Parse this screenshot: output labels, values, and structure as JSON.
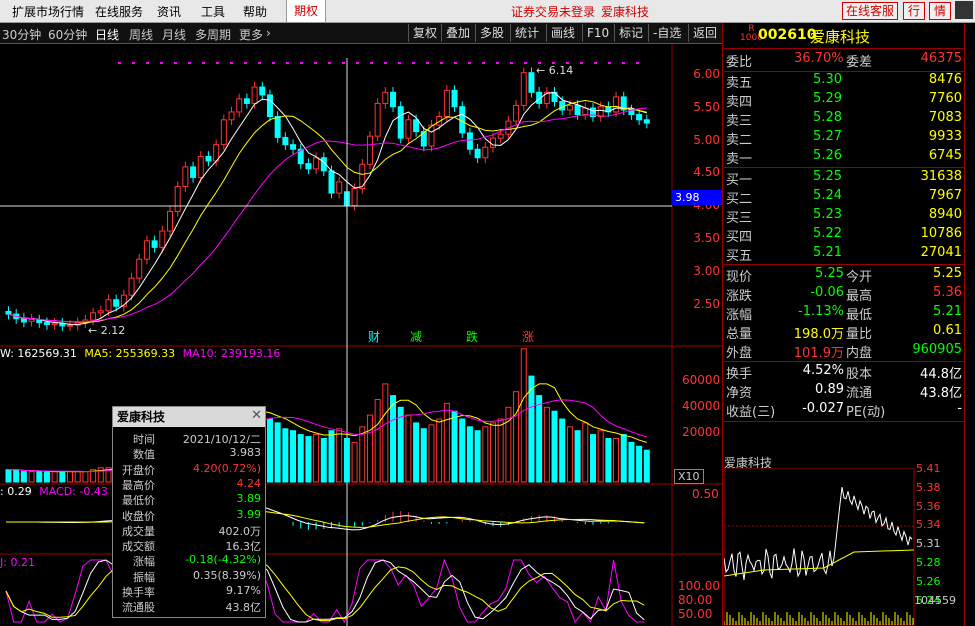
{
  "menu": {
    "items": [
      "扩展市场行情",
      "在线服务",
      "资讯",
      "工具",
      "帮助"
    ],
    "futures_tab": "期权",
    "status": "证券交易未登录",
    "stock_name": "爱康科技",
    "online_service": "在线客服",
    "quote_btn": "行",
    "quote_btn2": "情"
  },
  "toolbar": {
    "periods": [
      "30分钟",
      "60分钟",
      "日线",
      "周线",
      "月线",
      "多周期",
      "更多"
    ],
    "active_period": "日线",
    "tools": [
      "复权",
      "叠加",
      "多股",
      "统计",
      "画线",
      "F10",
      "标记",
      "-自选",
      "返回"
    ]
  },
  "quote": {
    "code": "002610",
    "name": "爱康科技",
    "r_label": "R",
    "r_sub": "1000",
    "webi_label": "委比",
    "webi": "36.70%",
    "weicha_label": "委差",
    "weicha": "46375",
    "asks": [
      {
        "label": "卖五",
        "price": "5.30",
        "vol": "8476"
      },
      {
        "label": "卖四",
        "price": "5.29",
        "vol": "7760"
      },
      {
        "label": "卖三",
        "price": "5.28",
        "vol": "7083"
      },
      {
        "label": "卖二",
        "price": "5.27",
        "vol": "9933"
      },
      {
        "label": "卖一",
        "price": "5.26",
        "vol": "6745"
      }
    ],
    "bids": [
      {
        "label": "买一",
        "price": "5.25",
        "vol": "31638"
      },
      {
        "label": "买二",
        "price": "5.24",
        "vol": "7967"
      },
      {
        "label": "买三",
        "price": "5.23",
        "vol": "8940"
      },
      {
        "label": "买四",
        "price": "5.22",
        "vol": "10786"
      },
      {
        "label": "买五",
        "price": "5.21",
        "vol": "27041"
      }
    ],
    "stats": [
      {
        "l1": "现价",
        "v1": "5.25",
        "l2": "今开",
        "v2": "5.25"
      },
      {
        "l1": "涨跌",
        "v1": "-0.06",
        "l2": "最高",
        "v2": "5.36"
      },
      {
        "l1": "涨幅",
        "v1": "-1.13%",
        "l2": "最低",
        "v2": "5.21"
      },
      {
        "l1": "总量",
        "v1": "198.0万",
        "l2": "量比",
        "v2": "0.61"
      },
      {
        "l1": "外盘",
        "v1": "101.9万",
        "l2": "内盘",
        "v2": "960905"
      }
    ],
    "stats2": [
      {
        "l1": "换手",
        "v1": "4.52%",
        "l2": "股本",
        "v2": "44.8亿"
      },
      {
        "l1": "净资",
        "v1": "0.89",
        "l2": "流通",
        "v2": "43.8亿"
      },
      {
        "l1": "收益(三)",
        "v1": "-0.027",
        "l2": "PE(动)",
        "v2": "-"
      }
    ],
    "mini_title": "爱康科技",
    "mini_ticks": [
      "5.41",
      "5.38",
      "5.36",
      "5.34",
      "5.31",
      "5.28",
      "5.26",
      "5.24"
    ],
    "mini_vol": "104559"
  },
  "chart": {
    "price_ticks": [
      "6.00",
      "5.50",
      "5.00",
      "4.50",
      "4.00",
      "3.50",
      "3.00",
      "2.50"
    ],
    "crosshair_price": "3.98",
    "high_label": "6.14",
    "low_label": "2.12",
    "events": [
      "财",
      "减",
      "跌",
      "涨"
    ],
    "vol_header": {
      "v": "W: 162569.31",
      "ma5": "MA5: 255369.33",
      "ma10": "MA10: 239193.16"
    },
    "vol_ticks": [
      "60000",
      "40000",
      "20000"
    ],
    "vol_unit": "X10",
    "macd_header": {
      "dif": ": 0.29",
      "macd": "MACD: -0.43"
    },
    "macd_tick": "0.50",
    "kdj_header": "J: 0.21",
    "kdj_ticks": [
      "100.00",
      "80.00",
      "50.00"
    ]
  },
  "popup": {
    "title": "爱康科技",
    "rows": [
      {
        "label": "时间",
        "value": "2021/10/12/二"
      },
      {
        "label": "数值",
        "value": "3.983"
      },
      {
        "label": "开盘价",
        "value": "4.20(0.72%)"
      },
      {
        "label": "最高价",
        "value": "4.24"
      },
      {
        "label": "最低价",
        "value": "3.89"
      },
      {
        "label": "收盘价",
        "value": "3.99"
      },
      {
        "label": "成交量",
        "value": "402.0万"
      },
      {
        "label": "成交额",
        "value": "16.3亿"
      },
      {
        "label": "涨幅",
        "value": "-0.18(-4.32%)"
      },
      {
        "label": "振幅",
        "value": "0.35(8.39%)"
      },
      {
        "label": "换手率",
        "value": "9.17%"
      },
      {
        "label": "流通股",
        "value": "43.8亿"
      }
    ]
  },
  "colors": {
    "up": "#ff3333",
    "down": "#00ffff",
    "ma5": "#ffffff",
    "ma10": "#ffff00",
    "ma20": "#ff00ff",
    "grid": "#990000"
  },
  "chart_data": {
    "type": "candlestick",
    "candles": [
      {
        "o": 2.37,
        "c": 2.33
      },
      {
        "o": 2.33,
        "c": 2.26
      },
      {
        "o": 2.27,
        "c": 2.21
      },
      {
        "o": 2.22,
        "c": 2.25
      },
      {
        "o": 2.24,
        "c": 2.2
      },
      {
        "o": 2.2,
        "c": 2.17
      },
      {
        "o": 2.17,
        "c": 2.19
      },
      {
        "o": 2.19,
        "c": 2.15
      },
      {
        "o": 2.15,
        "c": 2.16
      },
      {
        "o": 2.16,
        "c": 2.2
      },
      {
        "o": 2.2,
        "c": 2.24
      },
      {
        "o": 2.24,
        "c": 2.35
      },
      {
        "o": 2.35,
        "c": 2.38
      },
      {
        "o": 2.38,
        "c": 2.55
      },
      {
        "o": 2.55,
        "c": 2.45
      },
      {
        "o": 2.45,
        "c": 2.62
      },
      {
        "o": 2.62,
        "c": 2.88
      },
      {
        "o": 2.88,
        "c": 3.17
      },
      {
        "o": 3.17,
        "c": 3.45
      },
      {
        "o": 3.45,
        "c": 3.35
      },
      {
        "o": 3.35,
        "c": 3.6
      },
      {
        "o": 3.6,
        "c": 3.9
      },
      {
        "o": 3.9,
        "c": 4.28
      },
      {
        "o": 4.28,
        "c": 4.58
      },
      {
        "o": 4.58,
        "c": 4.42
      },
      {
        "o": 4.42,
        "c": 4.74
      },
      {
        "o": 4.74,
        "c": 4.67
      },
      {
        "o": 4.67,
        "c": 4.92
      },
      {
        "o": 4.92,
        "c": 5.3
      },
      {
        "o": 5.3,
        "c": 5.42
      },
      {
        "o": 5.42,
        "c": 5.62
      },
      {
        "o": 5.62,
        "c": 5.55
      },
      {
        "o": 5.55,
        "c": 5.8
      },
      {
        "o": 5.8,
        "c": 5.68
      },
      {
        "o": 5.68,
        "c": 5.35
      },
      {
        "o": 5.35,
        "c": 5.03
      },
      {
        "o": 5.03,
        "c": 4.92
      },
      {
        "o": 4.92,
        "c": 4.85
      },
      {
        "o": 4.85,
        "c": 4.63
      },
      {
        "o": 4.63,
        "c": 4.55
      },
      {
        "o": 4.55,
        "c": 4.72
      },
      {
        "o": 4.72,
        "c": 4.52
      },
      {
        "o": 4.52,
        "c": 4.18
      },
      {
        "o": 4.18,
        "c": 4.35
      },
      {
        "o": 4.2,
        "c": 3.99
      },
      {
        "o": 3.99,
        "c": 4.25
      },
      {
        "o": 4.25,
        "c": 4.62
      },
      {
        "o": 4.62,
        "c": 5.05
      },
      {
        "o": 5.05,
        "c": 5.55
      },
      {
        "o": 5.55,
        "c": 5.72
      },
      {
        "o": 5.72,
        "c": 5.5
      },
      {
        "o": 5.5,
        "c": 5.02
      },
      {
        "o": 5.02,
        "c": 5.3
      },
      {
        "o": 5.3,
        "c": 5.12
      },
      {
        "o": 5.12,
        "c": 4.9
      },
      {
        "o": 4.9,
        "c": 5.22
      },
      {
        "o": 5.22,
        "c": 5.35
      },
      {
        "o": 5.35,
        "c": 5.75
      },
      {
        "o": 5.75,
        "c": 5.5
      },
      {
        "o": 5.5,
        "c": 5.1
      },
      {
        "o": 5.1,
        "c": 4.85
      },
      {
        "o": 4.85,
        "c": 4.72
      },
      {
        "o": 4.72,
        "c": 4.88
      },
      {
        "o": 4.88,
        "c": 5.02
      },
      {
        "o": 5.02,
        "c": 5.08
      },
      {
        "o": 5.08,
        "c": 5.28
      },
      {
        "o": 5.28,
        "c": 5.52
      },
      {
        "o": 5.52,
        "c": 6.02
      },
      {
        "o": 6.02,
        "c": 5.72
      },
      {
        "o": 5.72,
        "c": 5.55
      },
      {
        "o": 5.55,
        "c": 5.72
      },
      {
        "o": 5.72,
        "c": 5.58
      },
      {
        "o": 5.58,
        "c": 5.45
      },
      {
        "o": 5.45,
        "c": 5.52
      },
      {
        "o": 5.52,
        "c": 5.38
      },
      {
        "o": 5.38,
        "c": 5.48
      },
      {
        "o": 5.48,
        "c": 5.35
      },
      {
        "o": 5.35,
        "c": 5.5
      },
      {
        "o": 5.5,
        "c": 5.42
      },
      {
        "o": 5.42,
        "c": 5.65
      },
      {
        "o": 5.65,
        "c": 5.45
      },
      {
        "o": 5.45,
        "c": 5.38
      },
      {
        "o": 5.38,
        "c": 5.3
      },
      {
        "o": 5.3,
        "c": 5.25
      }
    ],
    "volumes": [
      4,
      4,
      3,
      3,
      3,
      3,
      3,
      3,
      3,
      3,
      3,
      4,
      5,
      5,
      5,
      6,
      8,
      10,
      12,
      11,
      12,
      14,
      18,
      22,
      21,
      23,
      24,
      26,
      30,
      34,
      36,
      32,
      35,
      33,
      30,
      28,
      25,
      24,
      22,
      21,
      22,
      20,
      24,
      25,
      20,
      18,
      26,
      32,
      40,
      48,
      42,
      36,
      32,
      28,
      25,
      27,
      30,
      38,
      34,
      30,
      26,
      24,
      26,
      28,
      30,
      36,
      44,
      66,
      52,
      42,
      36,
      34,
      30,
      26,
      24,
      28,
      22,
      24,
      20,
      20,
      22,
      18,
      16,
      14
    ]
  }
}
